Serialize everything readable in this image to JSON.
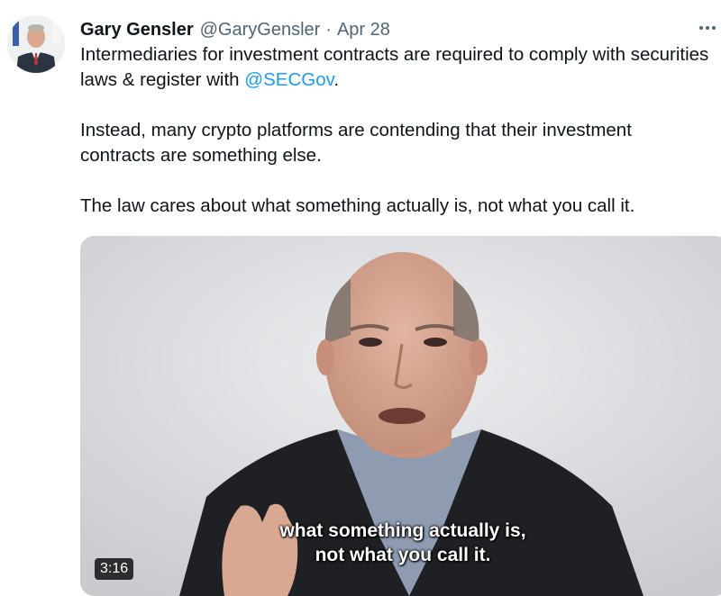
{
  "tweet": {
    "author": {
      "display_name": "Gary Gensler",
      "handle": "@GaryGensler",
      "avatar_icon": "profile-photo"
    },
    "separator": "·",
    "date": "Apr 28",
    "more_icon": "more-horizontal-icon",
    "text": {
      "p1_text": "Intermediaries for investment contracts are required to comply with securities laws & register with ",
      "p1_mention": "@SECGov",
      "p1_end": ".",
      "p2": "Instead, many crypto platforms are contending that their investment contracts are something else.",
      "p3": "The law cares about what something actually is, not what you call it."
    },
    "media": {
      "type": "video",
      "caption_line1": "what something actually is,",
      "caption_line2": "not what you call it.",
      "duration": "3:16"
    }
  },
  "colors": {
    "text": "#0f1419",
    "secondary": "#536471",
    "link": "#1d9bf0"
  }
}
